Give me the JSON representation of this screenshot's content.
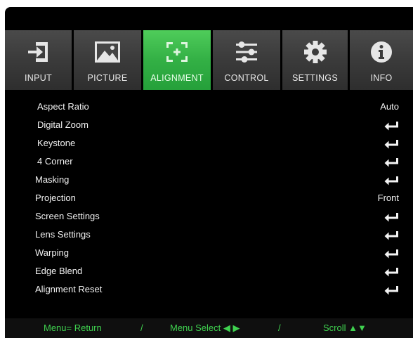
{
  "tabs": [
    {
      "label": "INPUT",
      "icon": "input-icon",
      "active": false
    },
    {
      "label": "PICTURE",
      "icon": "picture-icon",
      "active": false
    },
    {
      "label": "ALIGNMENT",
      "icon": "alignment-icon",
      "active": true
    },
    {
      "label": "CONTROL",
      "icon": "control-icon",
      "active": false
    },
    {
      "label": "SETTINGS",
      "icon": "settings-icon",
      "active": false
    },
    {
      "label": "INFO",
      "icon": "info-icon",
      "active": false
    }
  ],
  "menu": {
    "items": [
      {
        "label": "Aspect Ratio",
        "value": "Auto"
      },
      {
        "label": "Digital Zoom",
        "value": null,
        "icon": "enter-icon"
      },
      {
        "label": "Keystone",
        "value": null,
        "icon": "enter-icon"
      },
      {
        "label": "4 Corner",
        "value": null,
        "icon": "enter-icon"
      },
      {
        "label": "Masking",
        "value": null,
        "icon": "enter-icon"
      },
      {
        "label": "Projection",
        "value": "Front"
      },
      {
        "label": "Screen Settings",
        "value": null,
        "icon": "enter-icon"
      },
      {
        "label": "Lens Settings",
        "value": null,
        "icon": "enter-icon"
      },
      {
        "label": "Warping",
        "value": null,
        "icon": "enter-icon"
      },
      {
        "label": "Edge Blend",
        "value": null,
        "icon": "enter-icon"
      },
      {
        "label": "Alignment Reset",
        "value": null,
        "icon": "enter-icon"
      }
    ]
  },
  "footer": {
    "menu_return": "Menu= Return",
    "sep1": "/",
    "menu_select": "Menu Select ◀ ▶",
    "sep2": "/",
    "scroll": "Scroll ▲▼"
  },
  "colors": {
    "active_tab": "#33b045",
    "footer_text": "#3fd14f",
    "background": "#000000"
  }
}
